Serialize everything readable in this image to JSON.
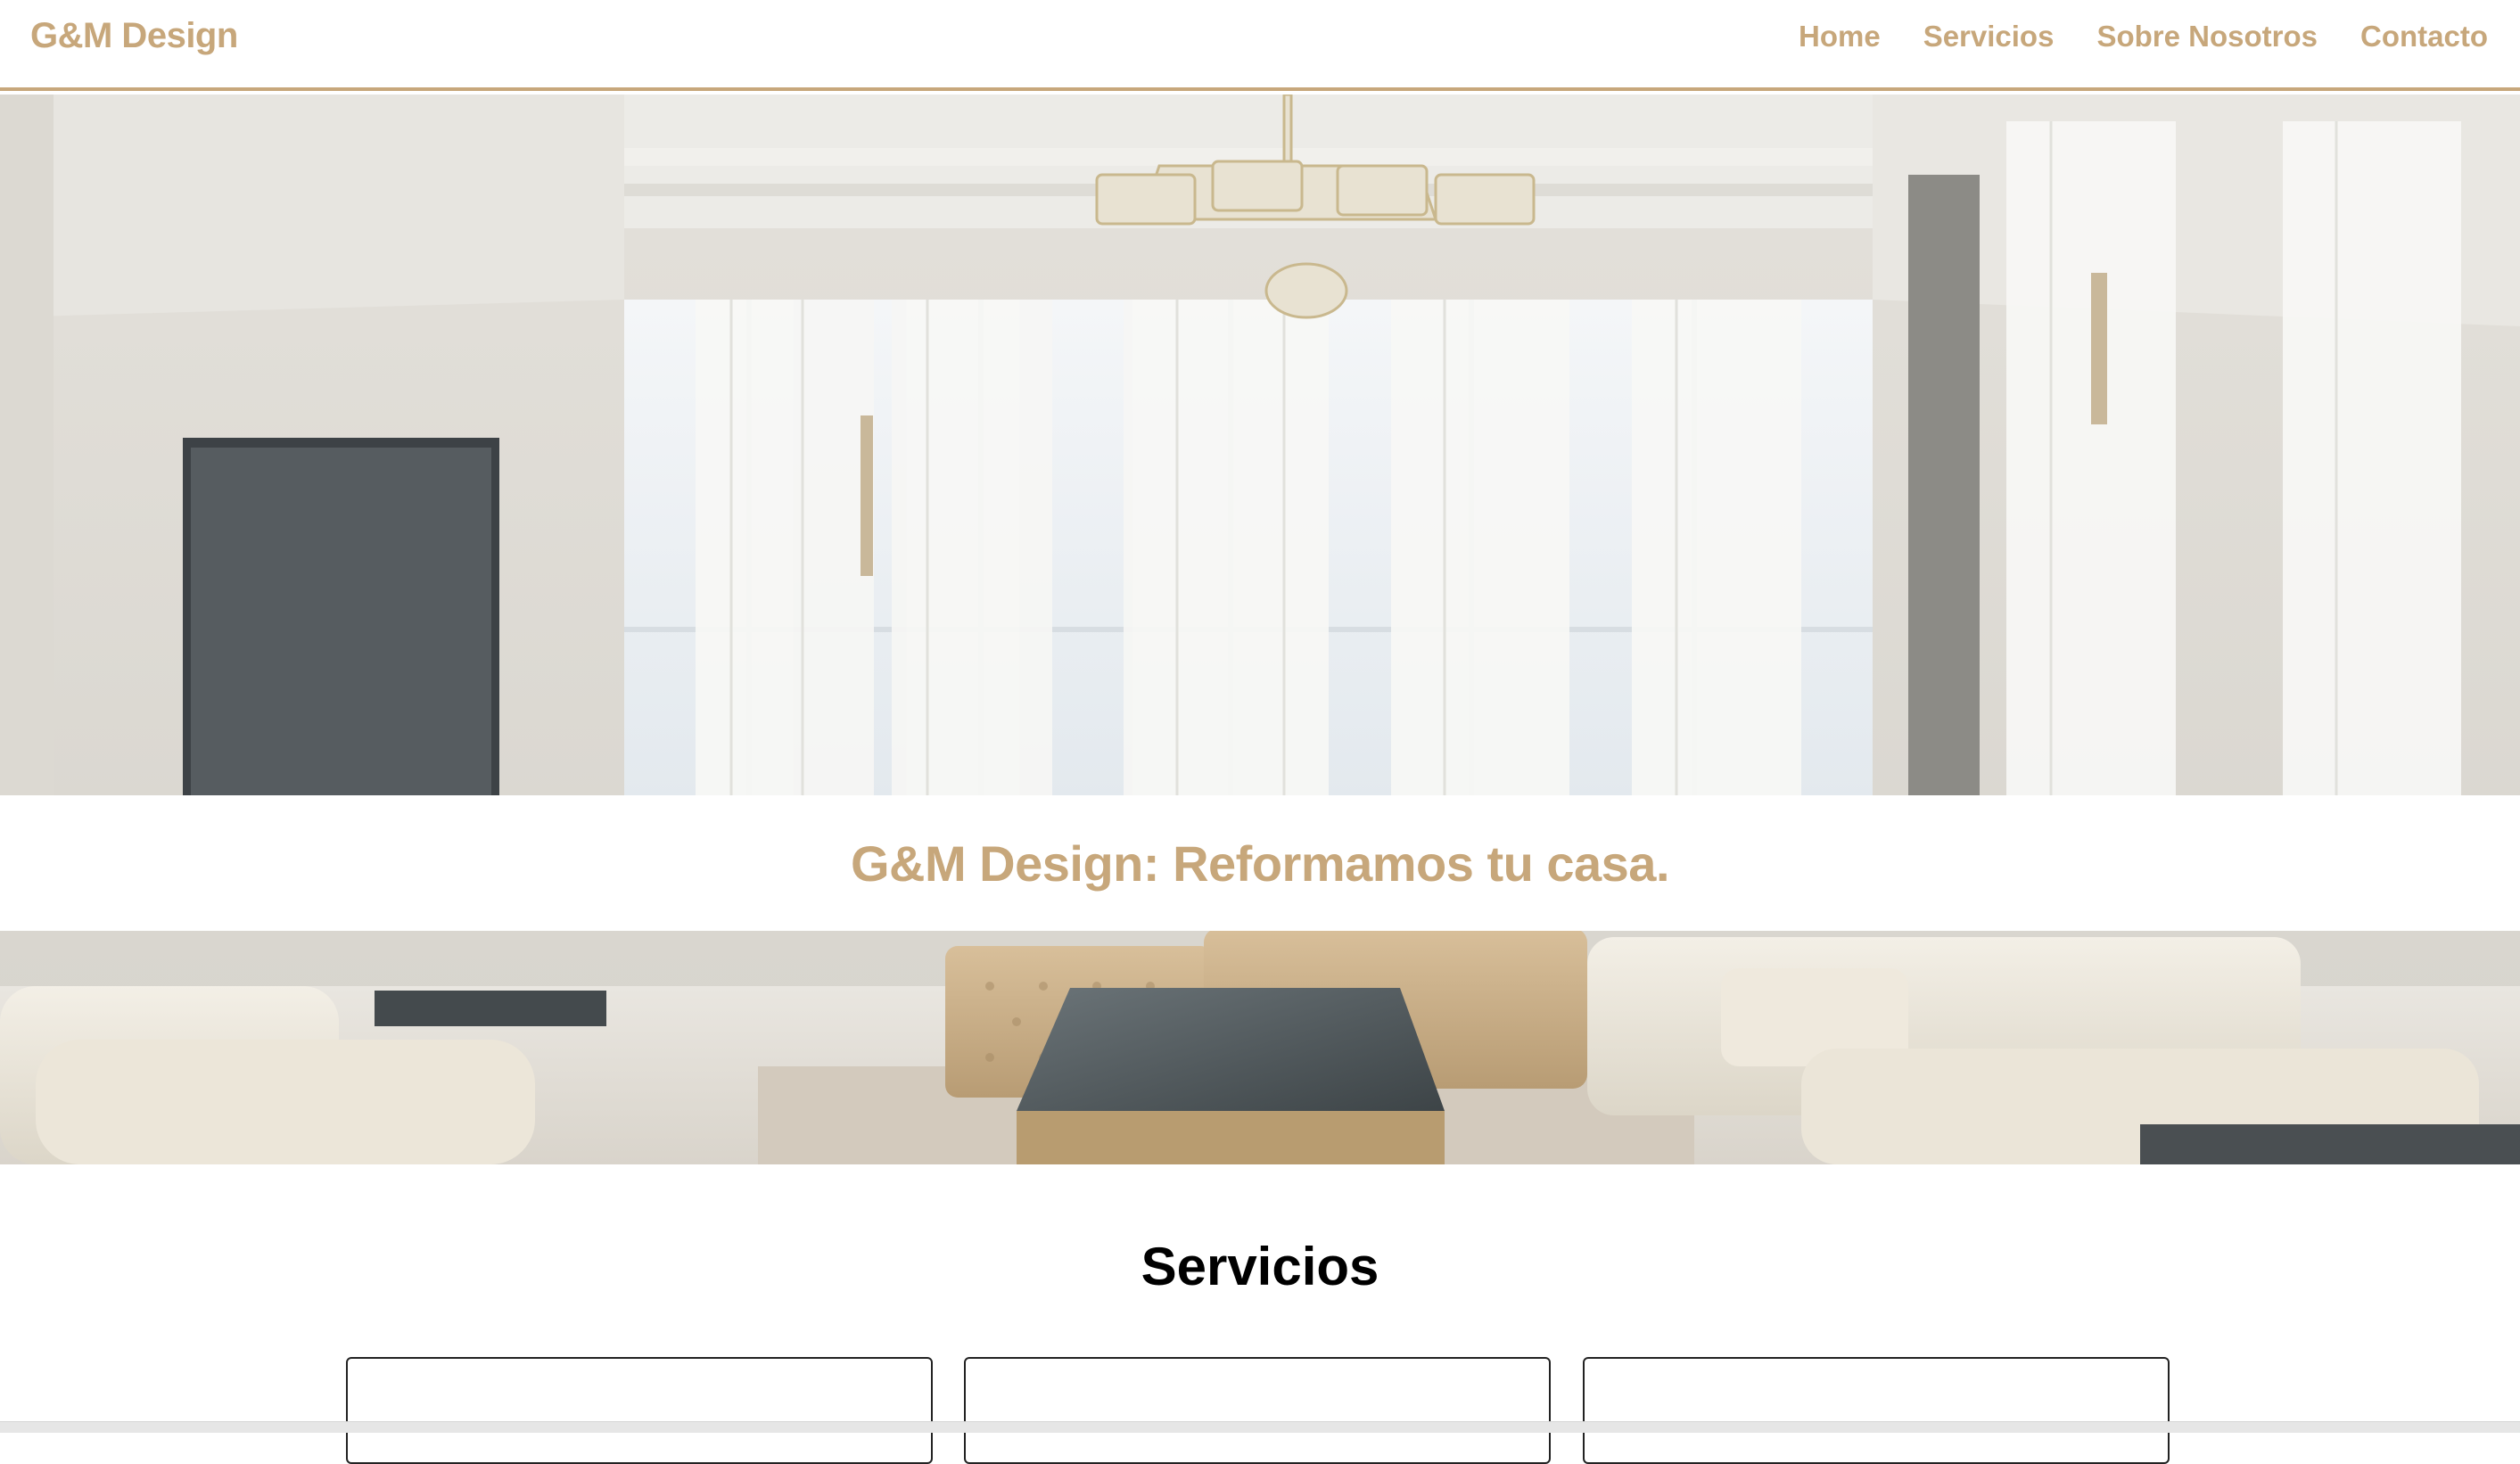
{
  "header": {
    "brand": "G&M Design",
    "nav": [
      {
        "label": "Home"
      },
      {
        "label": "Servicios"
      },
      {
        "label": "Sobre Nosotros"
      },
      {
        "label": "Contacto"
      }
    ]
  },
  "hero": {
    "title": "G&M Design: Reformamos tu casa."
  },
  "services": {
    "heading": "Servicios"
  },
  "colors": {
    "accent": "#c7a77b",
    "text": "#000000",
    "background": "#ffffff"
  }
}
